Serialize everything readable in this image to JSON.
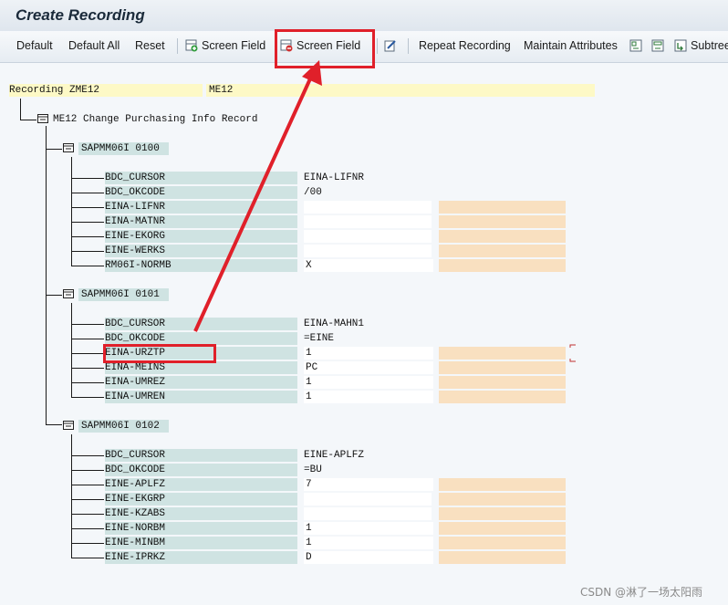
{
  "window": {
    "title": "Create Recording"
  },
  "toolbar": {
    "default": "Default",
    "default_all": "Default All",
    "reset": "Reset",
    "add_screen_field": "Screen Field",
    "remove_screen_field": "Screen Field",
    "repeat_recording": "Repeat Recording",
    "maintain_attributes": "Maintain Attributes",
    "subtree": "Subtree"
  },
  "recording": {
    "label": "Recording ZME12",
    "tcode": "ME12"
  },
  "root": {
    "label": "ME12 Change Purchasing Info Record"
  },
  "screens": [
    {
      "program": "SAPMM06I",
      "dynpro": "0100",
      "fields": [
        {
          "name": "BDC_CURSOR",
          "value": "EINA-LIFNR"
        },
        {
          "name": "BDC_OKCODE",
          "value": "/00"
        },
        {
          "name": "EINA-LIFNR",
          "value": ""
        },
        {
          "name": "EINA-MATNR",
          "value": ""
        },
        {
          "name": "EINE-EKORG",
          "value": ""
        },
        {
          "name": "EINE-WERKS",
          "value": ""
        },
        {
          "name": "RM06I-NORMB",
          "value": "X"
        }
      ]
    },
    {
      "program": "SAPMM06I",
      "dynpro": "0101",
      "fields": [
        {
          "name": "BDC_CURSOR",
          "value": "EINA-MAHN1"
        },
        {
          "name": "BDC_OKCODE",
          "value": "=EINE"
        },
        {
          "name": "EINA-URZTP",
          "value": "1"
        },
        {
          "name": "EINA-MEINS",
          "value": "PC"
        },
        {
          "name": "EINA-UMREZ",
          "value": "1"
        },
        {
          "name": "EINA-UMREN",
          "value": "1"
        }
      ]
    },
    {
      "program": "SAPMM06I",
      "dynpro": "0102",
      "fields": [
        {
          "name": "BDC_CURSOR",
          "value": "EINE-APLFZ"
        },
        {
          "name": "BDC_OKCODE",
          "value": "=BU"
        },
        {
          "name": "EINE-APLFZ",
          "value": "7"
        },
        {
          "name": "EINE-EKGRP",
          "value": ""
        },
        {
          "name": "EINE-KZABS",
          "value": ""
        },
        {
          "name": "EINE-NORBM",
          "value": "1"
        },
        {
          "name": "EINE-MINBM",
          "value": "1"
        },
        {
          "name": "EINE-IPRKZ",
          "value": "D"
        }
      ]
    }
  ],
  "watermark": "CSDN @淋了一场太阳雨",
  "colors": {
    "annotation": "#e0202a",
    "label_bg": "#cfe3e2",
    "value_bg": "#ffffff",
    "extra_bg": "#f9e0c0",
    "recording_bg": "#fdf9c6"
  }
}
